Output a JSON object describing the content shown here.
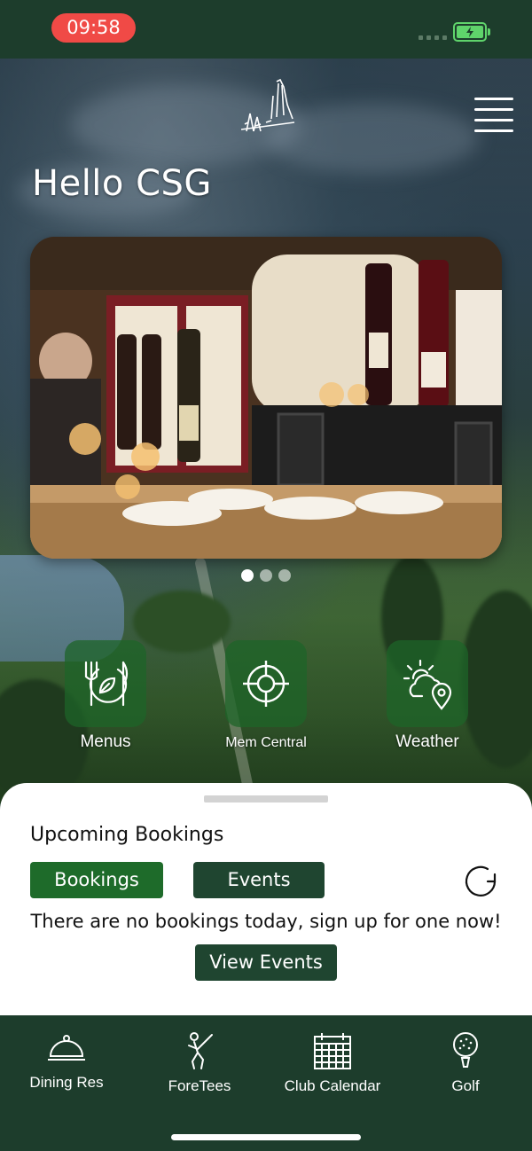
{
  "status_bar": {
    "time": "09:58"
  },
  "header": {
    "greeting": "Hello CSG"
  },
  "quick_actions": [
    {
      "label": "Menus",
      "icon": "menus-icon"
    },
    {
      "label": "Mem Central",
      "icon": "target-icon"
    },
    {
      "label": "Weather",
      "icon": "weather-location-icon"
    }
  ],
  "bookings": {
    "title": "Upcoming Bookings",
    "tab_bookings": "Bookings",
    "tab_events": "Events",
    "empty_message": "There are no bookings today, sign up for one now!",
    "view_events": "View Events"
  },
  "bottom_nav": [
    {
      "label": "Dining Res",
      "icon": "cloche-icon"
    },
    {
      "label": "ForeTees",
      "icon": "golfer-icon"
    },
    {
      "label": "Club Calendar",
      "icon": "calendar-icon"
    },
    {
      "label": "Golf",
      "icon": "golf-ball-icon"
    }
  ],
  "colors": {
    "brand_dark_green": "#1d3d2c",
    "active_tab_green": "#1e6b2a",
    "status_time_red": "#f04a46"
  }
}
